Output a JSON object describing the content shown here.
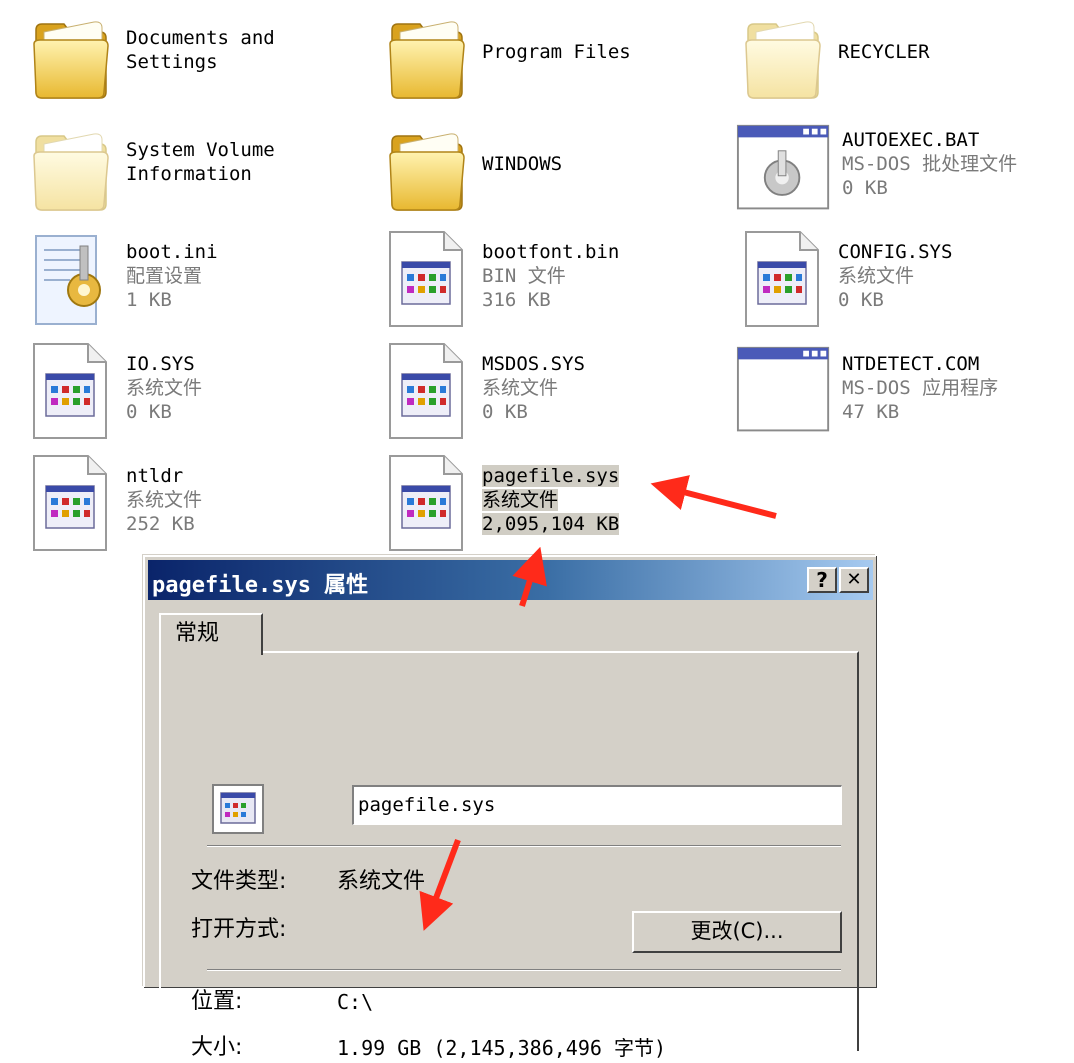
{
  "files": [
    {
      "icon": "folder-icon",
      "line1": "Documents and",
      "line2": "Settings",
      "line3": ""
    },
    {
      "icon": "folder-icon",
      "line1": "Program Files",
      "line2": "",
      "line3": ""
    },
    {
      "icon": "folder-faded-icon",
      "line1": "RECYCLER",
      "line2": "",
      "line3": ""
    },
    {
      "icon": "folder-faded-icon",
      "line1": "System Volume",
      "line2": "Information",
      "line3": ""
    },
    {
      "icon": "folder-icon",
      "line1": "WINDOWS",
      "line2": "",
      "line3": ""
    },
    {
      "icon": "batch-file-icon",
      "line1": "AUTOEXEC.BAT",
      "line2": "MS-DOS 批处理文件",
      "line3": "0 KB"
    },
    {
      "icon": "config-settings-icon",
      "line1": "boot.ini",
      "line2": "配置设置",
      "line3": "1 KB"
    },
    {
      "icon": "system-file-icon",
      "line1": "bootfont.bin",
      "line2": "BIN 文件",
      "line3": "316 KB"
    },
    {
      "icon": "system-file-icon",
      "line1": "CONFIG.SYS",
      "line2": "系统文件",
      "line3": "0 KB"
    },
    {
      "icon": "system-file-icon",
      "line1": "IO.SYS",
      "line2": "系统文件",
      "line3": "0 KB"
    },
    {
      "icon": "system-file-icon",
      "line1": "MSDOS.SYS",
      "line2": "系统文件",
      "line3": "0 KB"
    },
    {
      "icon": "dos-application-icon",
      "line1": "NTDETECT.COM",
      "line2": "MS-DOS 应用程序",
      "line3": "47 KB"
    },
    {
      "icon": "system-file-icon",
      "line1": "ntldr",
      "line2": "系统文件",
      "line3": "252 KB"
    },
    {
      "icon": "system-file-icon",
      "line1": "pagefile.sys",
      "line2": "系统文件",
      "line3": "2,095,104 KB"
    }
  ],
  "dialog": {
    "title": "pagefile.sys 属性",
    "help_button": "?",
    "close_button": "✕",
    "tab_label": "常规",
    "file_name": "pagefile.sys",
    "type_label": "文件类型:",
    "type_value": "系统文件",
    "opens_with_label": "打开方式:",
    "change_button": "更改(C)...",
    "location_label": "位置:",
    "location_value": "C:\\",
    "size_label": "大小:",
    "size_value": "1.99 GB (2,145,386,496 字节)"
  },
  "colors": {
    "annotation_arrow": "#ff2a1a",
    "title_bar_start": "#0a246a",
    "title_bar_end": "#a6caf0",
    "dialog_face": "#d4d0c8"
  }
}
